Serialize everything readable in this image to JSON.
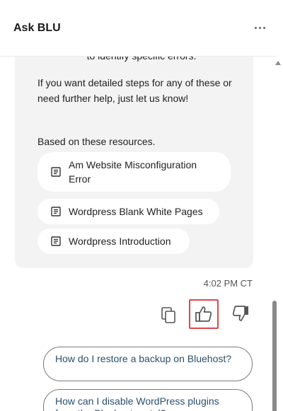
{
  "header": {
    "title": "Ask BLU",
    "menu_icon": "more-horizontal-icon"
  },
  "message": {
    "cut_line": "to identify specific errors.",
    "paragraph": "If you want detailed steps for any of these or need further help, just let us know!",
    "resources_label": "Based on these resources.",
    "resources": [
      {
        "label": "Am Website Misconfiguration Error"
      },
      {
        "label": "Wordpress Blank White Pages"
      },
      {
        "label": "Wordpress Introduction"
      }
    ],
    "timestamp": "4:02 PM CT"
  },
  "actions": {
    "copy_icon": "copy-icon",
    "like_icon": "thumbs-up-icon",
    "dislike_icon": "thumbs-down-icon",
    "highlight_color": "#e0464b"
  },
  "suggestions": [
    "How do I restore a backup on Bluehost?",
    "How can I disable WordPress plugins from the Bluehost portal?"
  ]
}
